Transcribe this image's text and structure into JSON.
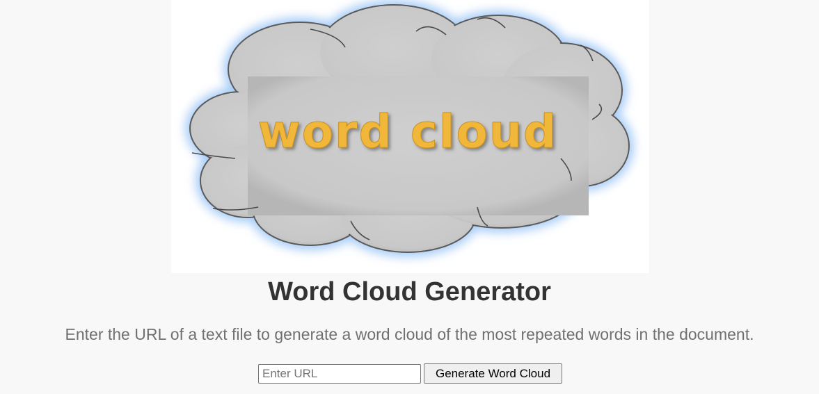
{
  "hero": {
    "logo_text": "word cloud",
    "cloud_color": "#cccccc",
    "glow_color": "#a9cdf7",
    "text_color": "#f0b73a"
  },
  "main": {
    "title": "Word Cloud Generator",
    "description": "Enter the URL of a text file to generate a word cloud of the most repeated words in the document."
  },
  "form": {
    "url_placeholder": "Enter URL",
    "url_value": "",
    "submit_label": "Generate Word Cloud"
  }
}
